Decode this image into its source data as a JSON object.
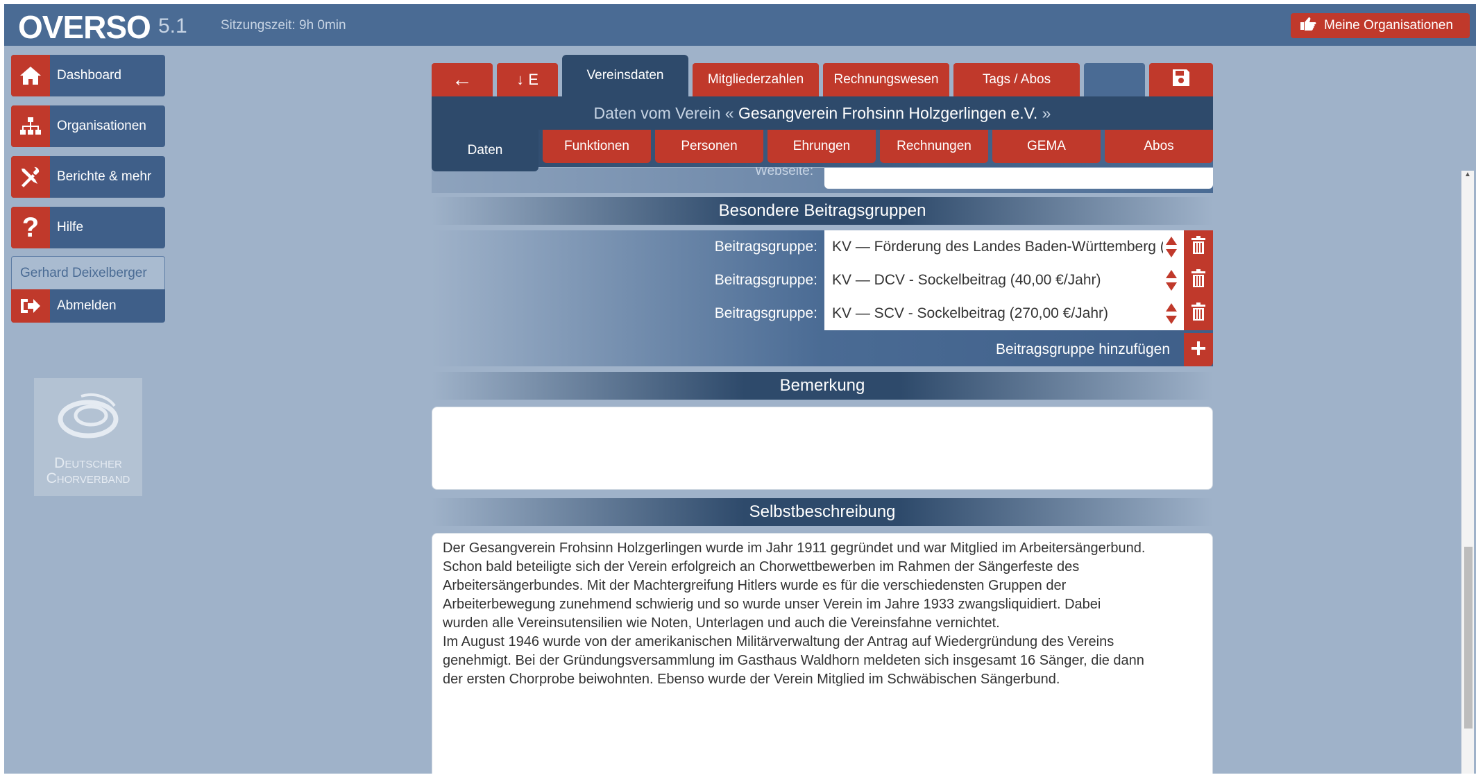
{
  "app": {
    "logo": "OVERSO",
    "version": "5.1",
    "session": "Sitzungszeit: 9h 0min",
    "orgs_button": "Meine Organisationen"
  },
  "sidebar": {
    "items": [
      {
        "label": "Dashboard",
        "icon": "home-icon"
      },
      {
        "label": "Organisationen",
        "icon": "sitemap-icon"
      },
      {
        "label": "Berichte & mehr",
        "icon": "tools-icon"
      },
      {
        "label": "Hilfe",
        "icon": "question-icon"
      }
    ],
    "user": "Gerhard Deixelberger",
    "logout": "Abmelden",
    "partner_logo_line1": "Deutscher",
    "partner_logo_line2": "Chorverband"
  },
  "tabs": {
    "back": "←",
    "sort": "↓ E",
    "items": [
      "Vereinsdaten",
      "Mitgliederzahlen",
      "Rechnungswesen",
      "Tags / Abos"
    ],
    "active": "Vereinsdaten"
  },
  "header": {
    "prefix": "Daten vom Verein «",
    "name": "Gesangverein Frohsinn Holzgerlingen e.V.",
    "suffix": "»"
  },
  "subtabs": {
    "items": [
      "Daten",
      "Funktionen",
      "Personen",
      "Ehrungen",
      "Rechnungen",
      "GEMA",
      "Abos"
    ],
    "active": "Daten"
  },
  "form": {
    "website_label": "Webseite:",
    "groups_title": "Besondere Beitragsgruppen",
    "group_label": "Beitragsgruppe:",
    "groups": [
      "KV — Förderung des Landes Baden-Württemberg (",
      "KV — DCV - Sockelbeitrag (40,00 €/Jahr)",
      "KV — SCV - Sockelbeitrag (270,00 €/Jahr)"
    ],
    "add_group": "Beitragsgruppe hinzufügen",
    "remark_title": "Bemerkung",
    "remark_value": "",
    "description_title": "Selbstbeschreibung",
    "description_value": "Der Gesangverein Frohsinn Holzgerlingen wurde im Jahr 1911 gegründet und war Mitglied im Arbeitersängerbund.\nSchon bald beteiligte sich der Verein erfolgreich an Chorwettbewerben im Rahmen der Sängerfeste des\nArbeitersängerbundes. Mit der Machtergreifung Hitlers wurde es für die verschiedensten Gruppen der\nArbeiterbewegung zunehmend schwierig und so wurde unser Verein im Jahre 1933 zwangsliquidiert. Dabei\nwurden alle Vereinsutensilien wie Noten, Unterlagen und auch die Vereinsfahne vernichtet.\nIm August 1946 wurde von der amerikanischen Militärverwaltung der Antrag auf Wiedergründung des Vereins\ngenehmigt. Bei der Gründungsversammlung im Gasthaus Waldhorn meldeten sich insgesamt 16 Sänger, die dann\nder ersten Chorprobe beiwohnten. Ebenso wurde der Verein Mitglied im Schwäbischen Sängerbund."
  },
  "colors": {
    "topbar": "#4a6b94",
    "background": "#9fb2c9",
    "accent_red": "#c0392b",
    "dark_blue": "#2e4a6b"
  }
}
